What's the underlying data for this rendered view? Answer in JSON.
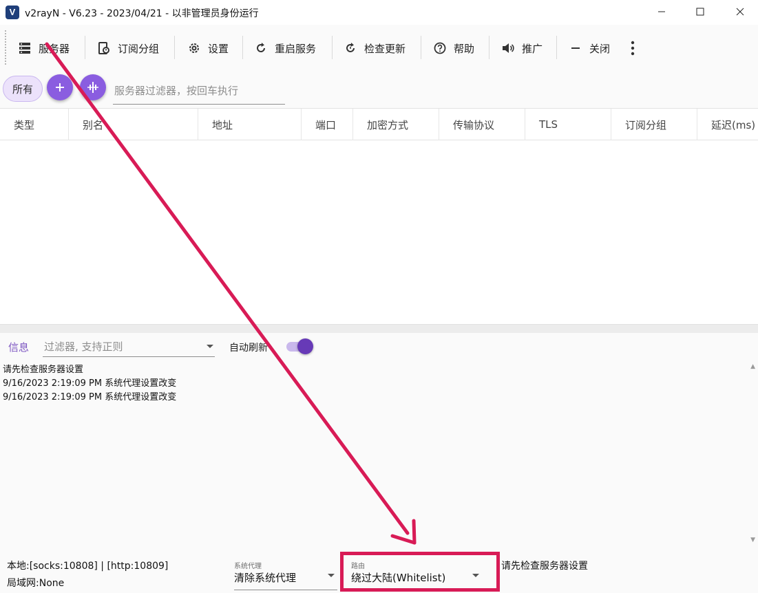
{
  "window": {
    "title": "v2rayN - V6.23 - 2023/04/21 - 以非管理员身份运行",
    "logo_letter": "V",
    "controls": [
      "minimize-icon",
      "maximize-icon",
      "close-icon"
    ]
  },
  "toolbar": {
    "items": [
      {
        "label": "服务器",
        "icon": "server-icon"
      },
      {
        "label": "订阅分组",
        "icon": "subscription-icon"
      },
      {
        "label": "设置",
        "icon": "gear-icon"
      },
      {
        "label": "重启服务",
        "icon": "restart-icon"
      },
      {
        "label": "检查更新",
        "icon": "update-icon"
      },
      {
        "label": "帮助",
        "icon": "help-icon"
      },
      {
        "label": "推广",
        "icon": "speaker-icon"
      },
      {
        "label": "关闭",
        "icon": "minus-icon"
      }
    ],
    "more_icon": "more-vert-icon"
  },
  "filter_bar": {
    "all_chip": "所有",
    "add_icon": "plus-icon",
    "action_icon": "split-icon",
    "search_placeholder": "服务器过滤器，按回车执行"
  },
  "table": {
    "columns": [
      "类型",
      "别名",
      "地址",
      "端口",
      "加密方式",
      "传输协议",
      "TLS",
      "订阅分组",
      "延迟(ms)"
    ],
    "rows": []
  },
  "messages": {
    "tab_label": "信息",
    "filter_placeholder": "过滤器, 支持正则",
    "auto_refresh_label": "自动刷新",
    "auto_refresh_on": true,
    "lines": [
      "请先检查服务器设置",
      "9/16/2023 2:19:09 PM 系统代理设置改变",
      "9/16/2023 2:19:09 PM 系统代理设置改变"
    ]
  },
  "status": {
    "local_ports": "本地:[socks:10808] | [http:10809]",
    "lan": "局域网:None",
    "system_proxy_label": "系统代理",
    "system_proxy_value": "清除系统代理",
    "routing_label": "路由",
    "routing_value": "绕过大陆(Whitelist)",
    "message": "请先检查服务器设置"
  },
  "colors": {
    "accent": "#673ab7",
    "fab": "#8a5de0",
    "annotation": "#d81b56"
  }
}
